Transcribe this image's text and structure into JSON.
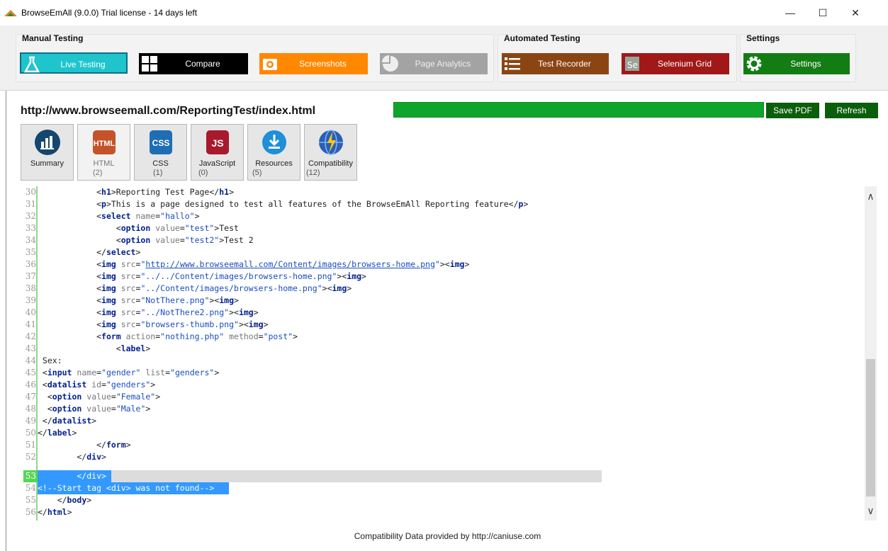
{
  "window": {
    "title": "BrowseEmAll (9.0.0) Trial license - 14 days left",
    "minimize_glyph": "—",
    "maximize_glyph": "☐",
    "close_glyph": "✕"
  },
  "ribbon": {
    "groups": {
      "manual": "Manual Testing",
      "automated": "Automated Testing",
      "settings": "Settings"
    },
    "buttons": {
      "live": "Live Testing",
      "compare": "Compare",
      "screenshots": "Screenshots",
      "analytics": "Page Analytics",
      "recorder": "Test Recorder",
      "grid": "Selenium Grid",
      "settings": "Settings"
    }
  },
  "main": {
    "url": "http://www.browseemall.com/ReportingTest/index.html",
    "progress": 1.0,
    "save_pdf": "Save PDF",
    "refresh": "Refresh",
    "tabs": [
      {
        "label": "Summary",
        "count": "",
        "icon": "bar-chart-icon"
      },
      {
        "label": "HTML",
        "count": "(2)",
        "icon": "html-icon"
      },
      {
        "label": "CSS",
        "count": "(1)",
        "icon": "css-icon"
      },
      {
        "label": "JavaScript",
        "count": "(0)",
        "icon": "js-icon"
      },
      {
        "label": "Resources",
        "count": "(5)",
        "icon": "download-icon"
      },
      {
        "label": "Compatibility",
        "count": "(12)",
        "icon": "globe-icon"
      }
    ],
    "footer": "Compatibility Data provided by http://caniuse.com"
  },
  "code": {
    "line_numbers": [
      "30",
      "31",
      "32",
      "33",
      "34",
      "35",
      "36",
      "37",
      "38",
      "39",
      "40",
      "41",
      "42",
      "43",
      "44",
      "45",
      "46",
      "47",
      "48",
      "49",
      "50",
      "51",
      "52",
      "53",
      "54",
      "55",
      "56"
    ],
    "line_54_text": "<!--Start tag <div> was not found-->"
  },
  "colors": {
    "live": "#1fc4cc",
    "compare": "#000000",
    "screenshots": "#ff8800",
    "analytics": "#a3a3a3",
    "recorder": "#8b4513",
    "grid": "#a01818",
    "settings": "#137c13",
    "progress": "#0fa52a",
    "selection": "#3399ff"
  }
}
